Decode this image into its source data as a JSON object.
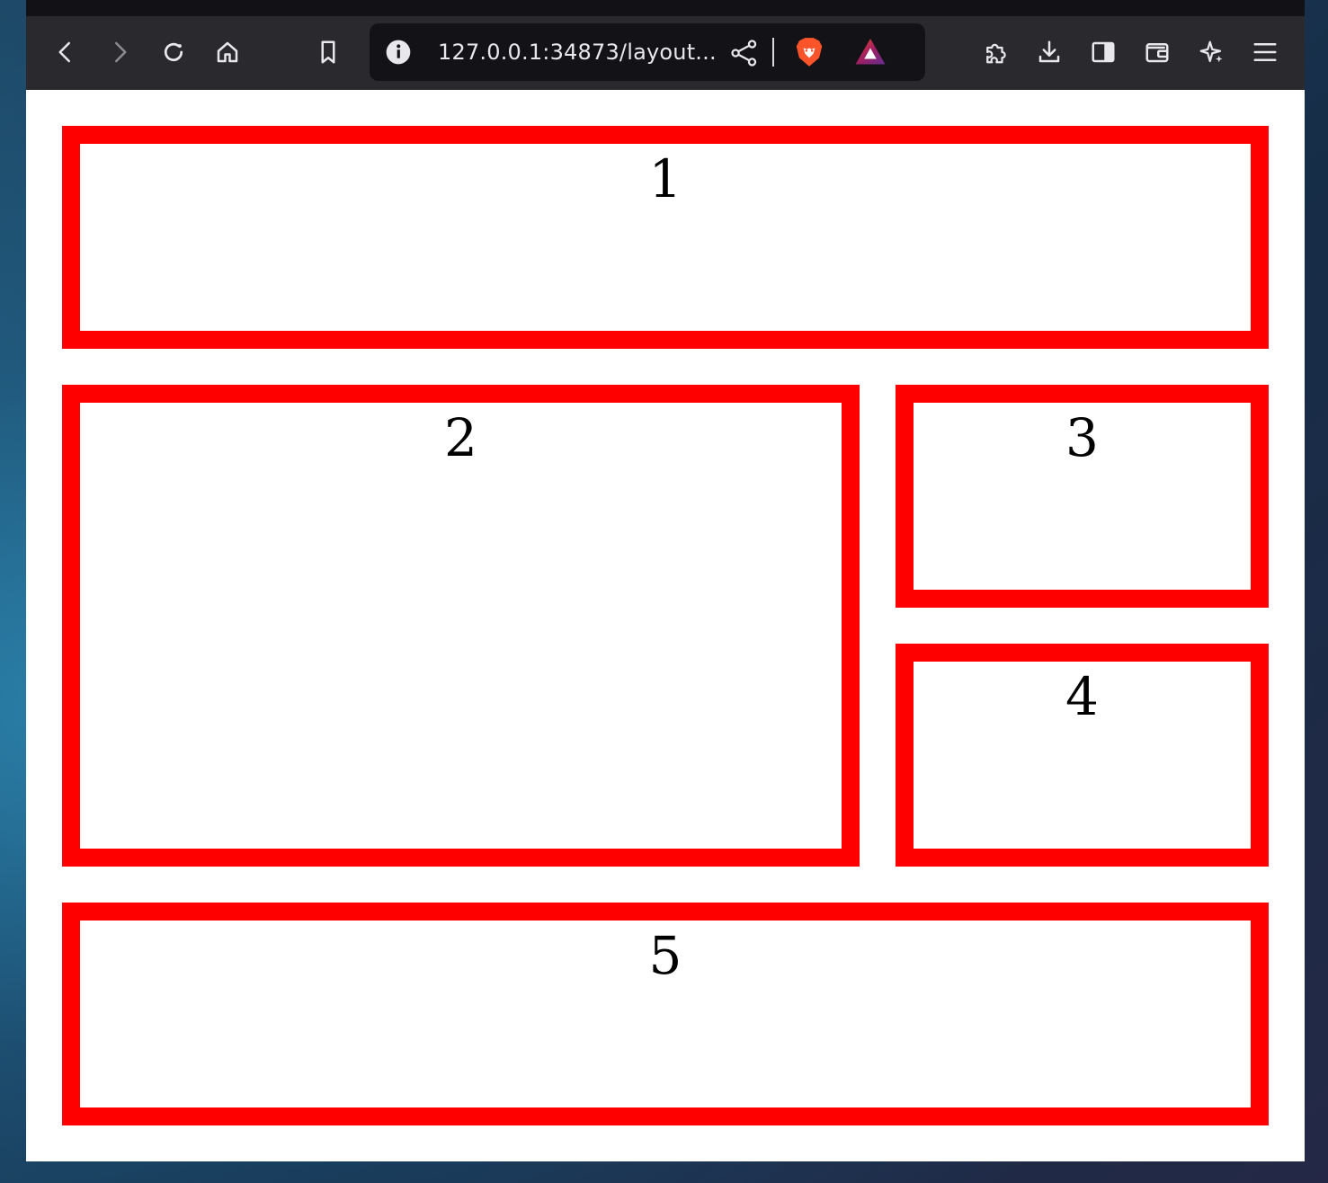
{
  "browser": {
    "url": "127.0.0.1:34873/layout...",
    "icons": {
      "back": "chevron-left-icon",
      "forward": "chevron-right-icon",
      "reload": "reload-icon",
      "home": "home-icon",
      "bookmark": "bookmark-icon",
      "info": "info-icon",
      "share": "share-icon",
      "brave_shields": "brave-lion-icon",
      "rewards": "bat-triangle-icon",
      "extensions": "puzzle-icon",
      "downloads": "download-icon",
      "sidebar": "sidebar-icon",
      "wallet": "wallet-icon",
      "leo": "sparkle-icon",
      "menu": "hamburger-menu-icon"
    }
  },
  "page": {
    "boxes": [
      {
        "label": "1"
      },
      {
        "label": "2"
      },
      {
        "label": "3"
      },
      {
        "label": "4"
      },
      {
        "label": "5"
      }
    ],
    "colors": {
      "border": "#ff0000",
      "background": "#ffffff",
      "text": "#000000"
    }
  }
}
